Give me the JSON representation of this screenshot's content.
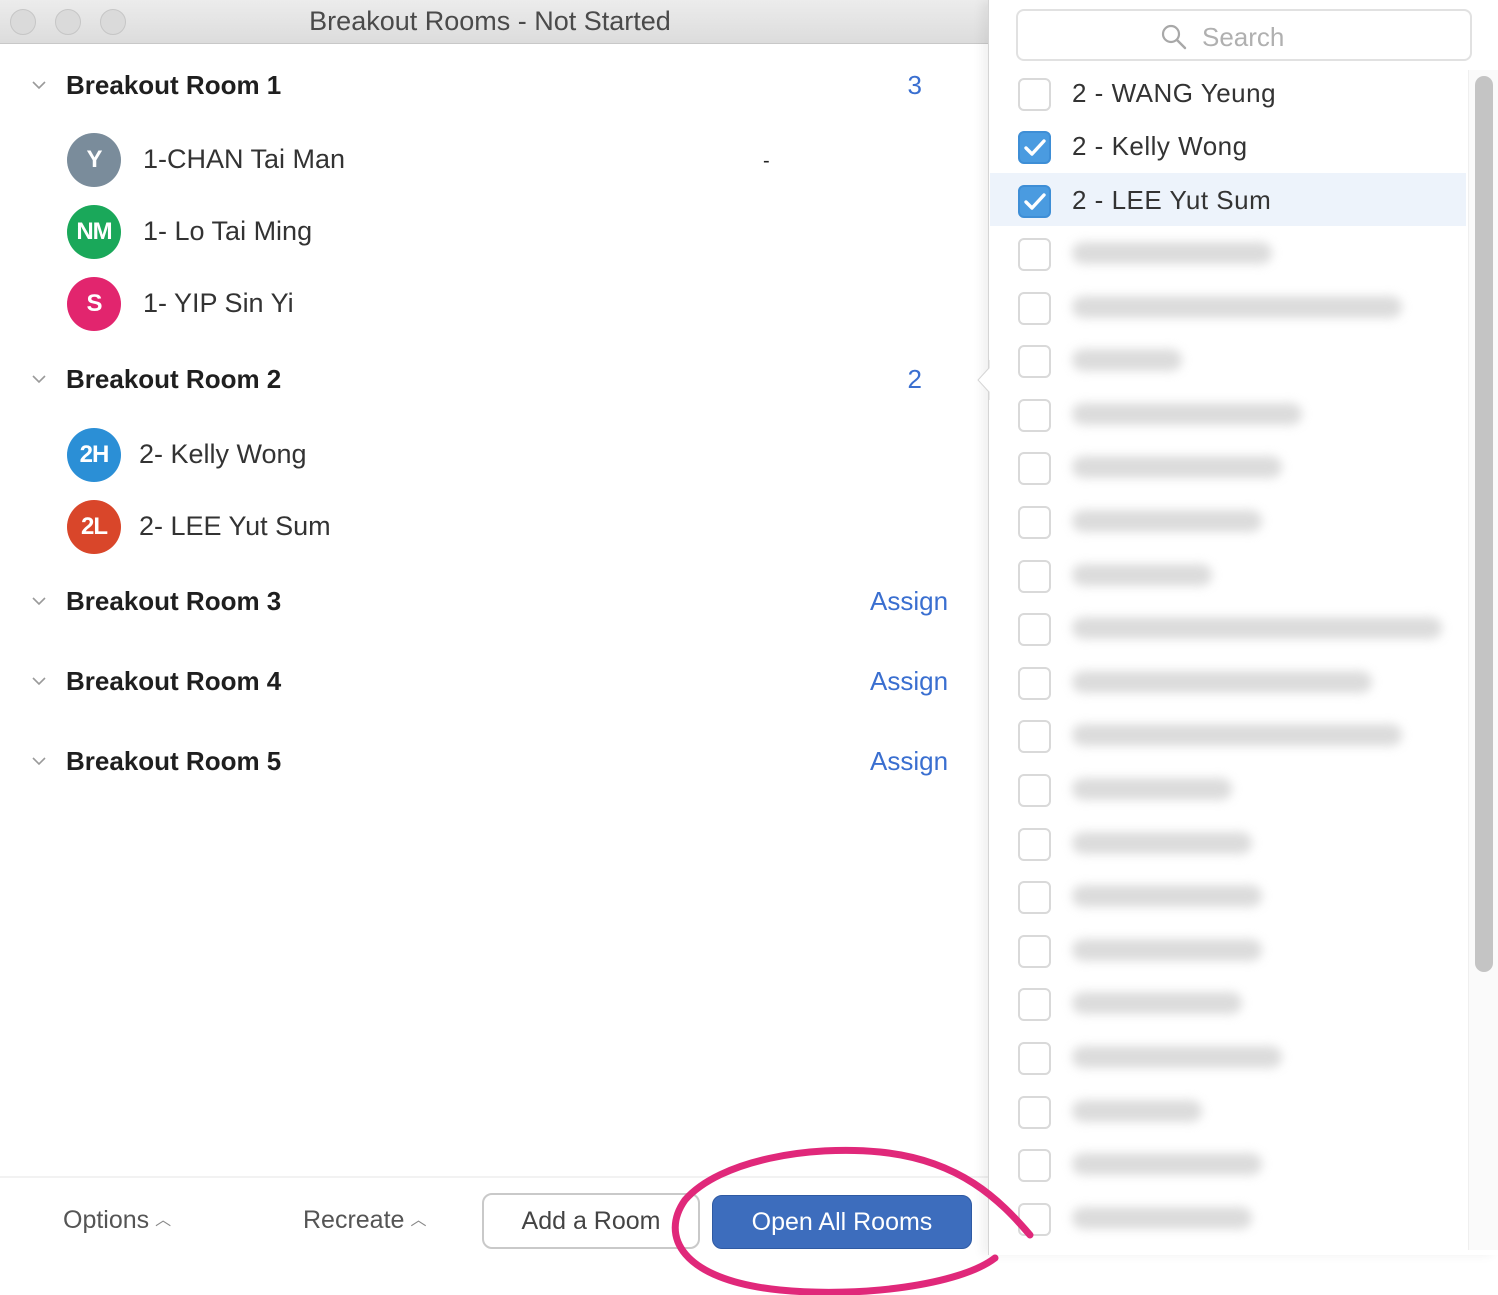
{
  "window": {
    "title": "Breakout Rooms - Not Started"
  },
  "rooms": [
    {
      "name": "Breakout Room 1",
      "count": "3",
      "members": [
        {
          "initials": "Y",
          "name": "1-CHAN Tai Man",
          "color": "#7a8c9b"
        },
        {
          "initials": "NM",
          "name": "1- Lo Tai Ming",
          "color": "#1aa85a"
        },
        {
          "initials": "S",
          "name": "1- YIP Sin Yi",
          "color": "#e2256e"
        }
      ]
    },
    {
      "name": "Breakout Room 2",
      "count": "2",
      "members": [
        {
          "initials": "2H",
          "name": "2- Kelly Wong",
          "color": "#2b8fd6"
        },
        {
          "initials": "2L",
          "name": "2- LEE Yut Sum",
          "color": "#d9462a"
        }
      ]
    },
    {
      "name": "Breakout Room 3",
      "assign_label": "Assign"
    },
    {
      "name": "Breakout Room 4",
      "assign_label": "Assign"
    },
    {
      "name": "Breakout Room 5",
      "assign_label": "Assign"
    }
  ],
  "stray_text": "-",
  "footer": {
    "options_label": "Options",
    "recreate_label": "Recreate",
    "add_room_label": "Add a Room",
    "open_all_label": "Open All Rooms"
  },
  "panel": {
    "search_placeholder": "Search",
    "participants": [
      {
        "name": "2 - WANG Yeung",
        "checked": false
      },
      {
        "name": "2 - Kelly Wong",
        "checked": true
      },
      {
        "name": "2 - LEE Yut Sum",
        "checked": true,
        "highlighted": true
      }
    ],
    "blurred_participant_count": 19
  },
  "colors": {
    "accent": "#3d6dbd",
    "link": "#3a6fd0",
    "checkbox": "#4a9be0",
    "annotation": "#e0287a"
  }
}
